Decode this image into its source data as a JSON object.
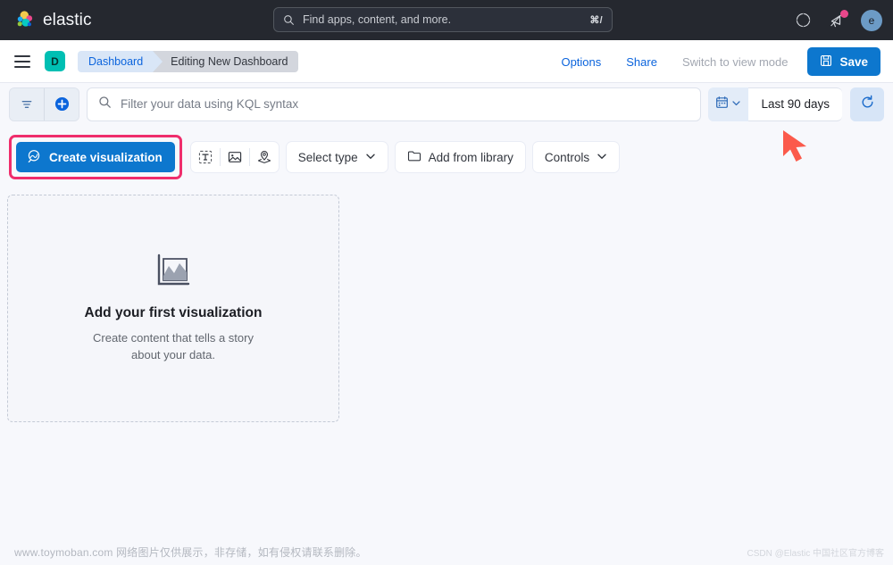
{
  "chrome": {
    "brand": "elastic",
    "logo_icon": "elastic-logo",
    "search": {
      "placeholder": "Find apps, content, and more.",
      "value": "",
      "shortcut": "⌘/",
      "icon": "search-icon"
    },
    "help_icon": "help-icon",
    "news_icon": "announcement-icon",
    "avatar_initial": "e",
    "notification_badge_color": "#E9478B"
  },
  "header": {
    "menu_icon": "hamburger-menu-icon",
    "space_badge": "D",
    "breadcrumbs": [
      {
        "label": "Dashboard",
        "active": false
      },
      {
        "label": "Editing New Dashboard",
        "active": true
      }
    ],
    "actions": [
      {
        "label": "Options",
        "state": "enabled"
      },
      {
        "label": "Share",
        "state": "enabled"
      },
      {
        "label": "Switch to view mode",
        "state": "disabled"
      }
    ],
    "save_label": "Save",
    "save_icon": "save-disk-icon"
  },
  "query_bar": {
    "filter_icon": "filter-icon",
    "add_filter_icon": "add-circle-icon",
    "search_icon": "search-icon",
    "kql_placeholder": "Filter your data using KQL syntax",
    "kql_value": "",
    "date_picker_icon": "calendar-icon",
    "date_dropdown_icon": "chevron-down-icon",
    "date_range": "Last 90 days",
    "refresh_icon": "refresh-icon"
  },
  "toolbar": {
    "create_visualization_label": "Create visualization",
    "create_visualization_icon": "lens-icon",
    "quick_icons": [
      {
        "name": "text-panel-icon"
      },
      {
        "name": "image-panel-icon"
      },
      {
        "name": "map-panel-icon"
      }
    ],
    "select_type_label": "Select type",
    "select_type_icon": "chevron-down-icon",
    "add_from_library_label": "Add from library",
    "add_from_library_icon": "folder-icon",
    "controls_label": "Controls",
    "controls_icon": "chevron-down-icon",
    "highlight_color": "#EF2D6C"
  },
  "empty_state": {
    "icon": "area-chart-icon",
    "title": "Add your first visualization",
    "subtitle": "Create content that tells a story about your data."
  },
  "annotation": {
    "arrow_icon": "red-arrow-cursor",
    "color": "#FB5A4B"
  },
  "watermarks": {
    "left": "www.toymoban.com 网络图片仅供展示，非存储，如有侵权请联系删除。",
    "right": "CSDN @Elastic 中国社区官方博客"
  },
  "theme": {
    "accent_blue": "#0D77CE",
    "link_blue": "#0B64DD",
    "chrome_bg": "#25282F",
    "page_bg": "#F7F8FC",
    "space_teal": "#00BFB3"
  }
}
